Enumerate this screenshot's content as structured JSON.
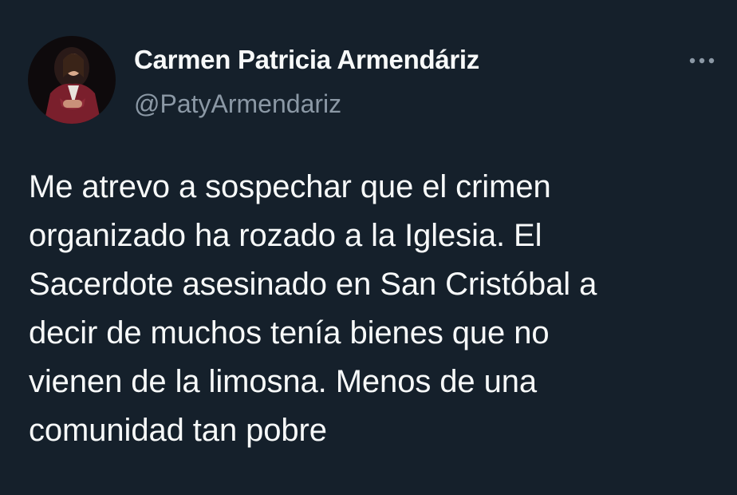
{
  "tweet": {
    "author": {
      "display_name": "Carmen Patricia Armendáriz",
      "handle": "@PatyArmendariz",
      "avatar_icon": "profile-photo"
    },
    "more_icon": "more-horizontal-icon",
    "text": "Me atrevo a sospechar que el crimen\norganizado ha rozado a la Iglesia. El\nSacerdote asesinado en San  Cristóbal a\ndecir de muchos tenía bienes que no\nvienen de la limosna. Menos de una\ncomunidad tan pobre"
  },
  "colors": {
    "background": "#15202b",
    "primary_text": "#f7f9f9",
    "secondary_text": "#8b98a5"
  }
}
